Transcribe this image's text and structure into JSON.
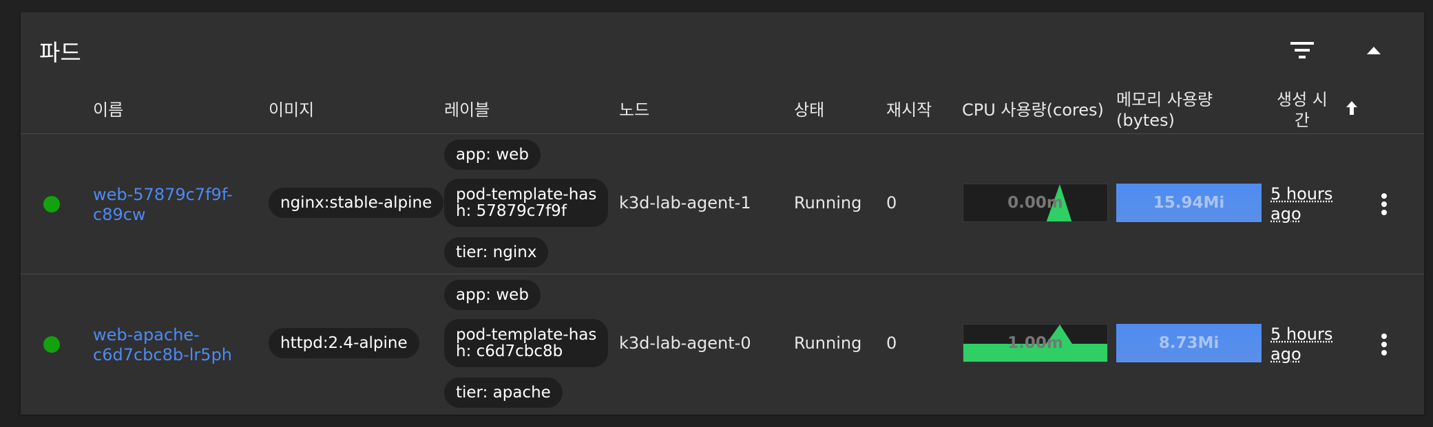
{
  "card": {
    "title": "파드",
    "filter_icon": "filter-icon",
    "collapse_icon": "chevron-up-icon"
  },
  "columns": {
    "name": "이름",
    "image": "이미지",
    "labels": "레이블",
    "node": "노드",
    "status": "상태",
    "restarts": "재시작",
    "cpu": "CPU 사용량(cores)",
    "memory_line1": "메모리 사용량",
    "memory_line2": "(bytes)",
    "created_line1": "생성 시",
    "created_line2": "간",
    "sort_icon": "arrow-up-icon"
  },
  "rows": [
    {
      "name_line1": "web-57879c7f9f-",
      "name_line2": "c89cw",
      "image": "nginx:stable-alpine",
      "labels": [
        "app: web",
        "pod-template-hash: 57879c7f9f",
        "tier: nginx"
      ],
      "label_hash_line1": "pod-template-has",
      "label_hash_line2": "h: 57879c7f9f",
      "node": "k3d-lab-agent-1",
      "status": "Running",
      "restarts": "0",
      "cpu": "0.00m",
      "memory": "15.94Mi",
      "age_line1": "5 hours",
      "age_line2": "ago",
      "status_color": "#13a10e"
    },
    {
      "name_line1": "web-apache-",
      "name_line2": "c6d7cbc8b-lr5ph",
      "image": "httpd:2.4-alpine",
      "labels": [
        "app: web",
        "pod-template-hash: c6d7cbc8b",
        "tier: apache"
      ],
      "label_hash_line1": "pod-template-has",
      "label_hash_line2": "h: c6d7cbc8b",
      "node": "k3d-lab-agent-0",
      "status": "Running",
      "restarts": "0",
      "cpu": "1.00m",
      "memory": "8.73Mi",
      "age_line1": "5 hours",
      "age_line2": "ago",
      "status_color": "#13a10e"
    }
  ],
  "colors": {
    "background": "#212121",
    "card": "#303030",
    "link": "#4c8bf5",
    "chip": "#1f1f1f",
    "cpu_fill": "#2fcf66",
    "memory_fill": "#5a8fe8"
  }
}
